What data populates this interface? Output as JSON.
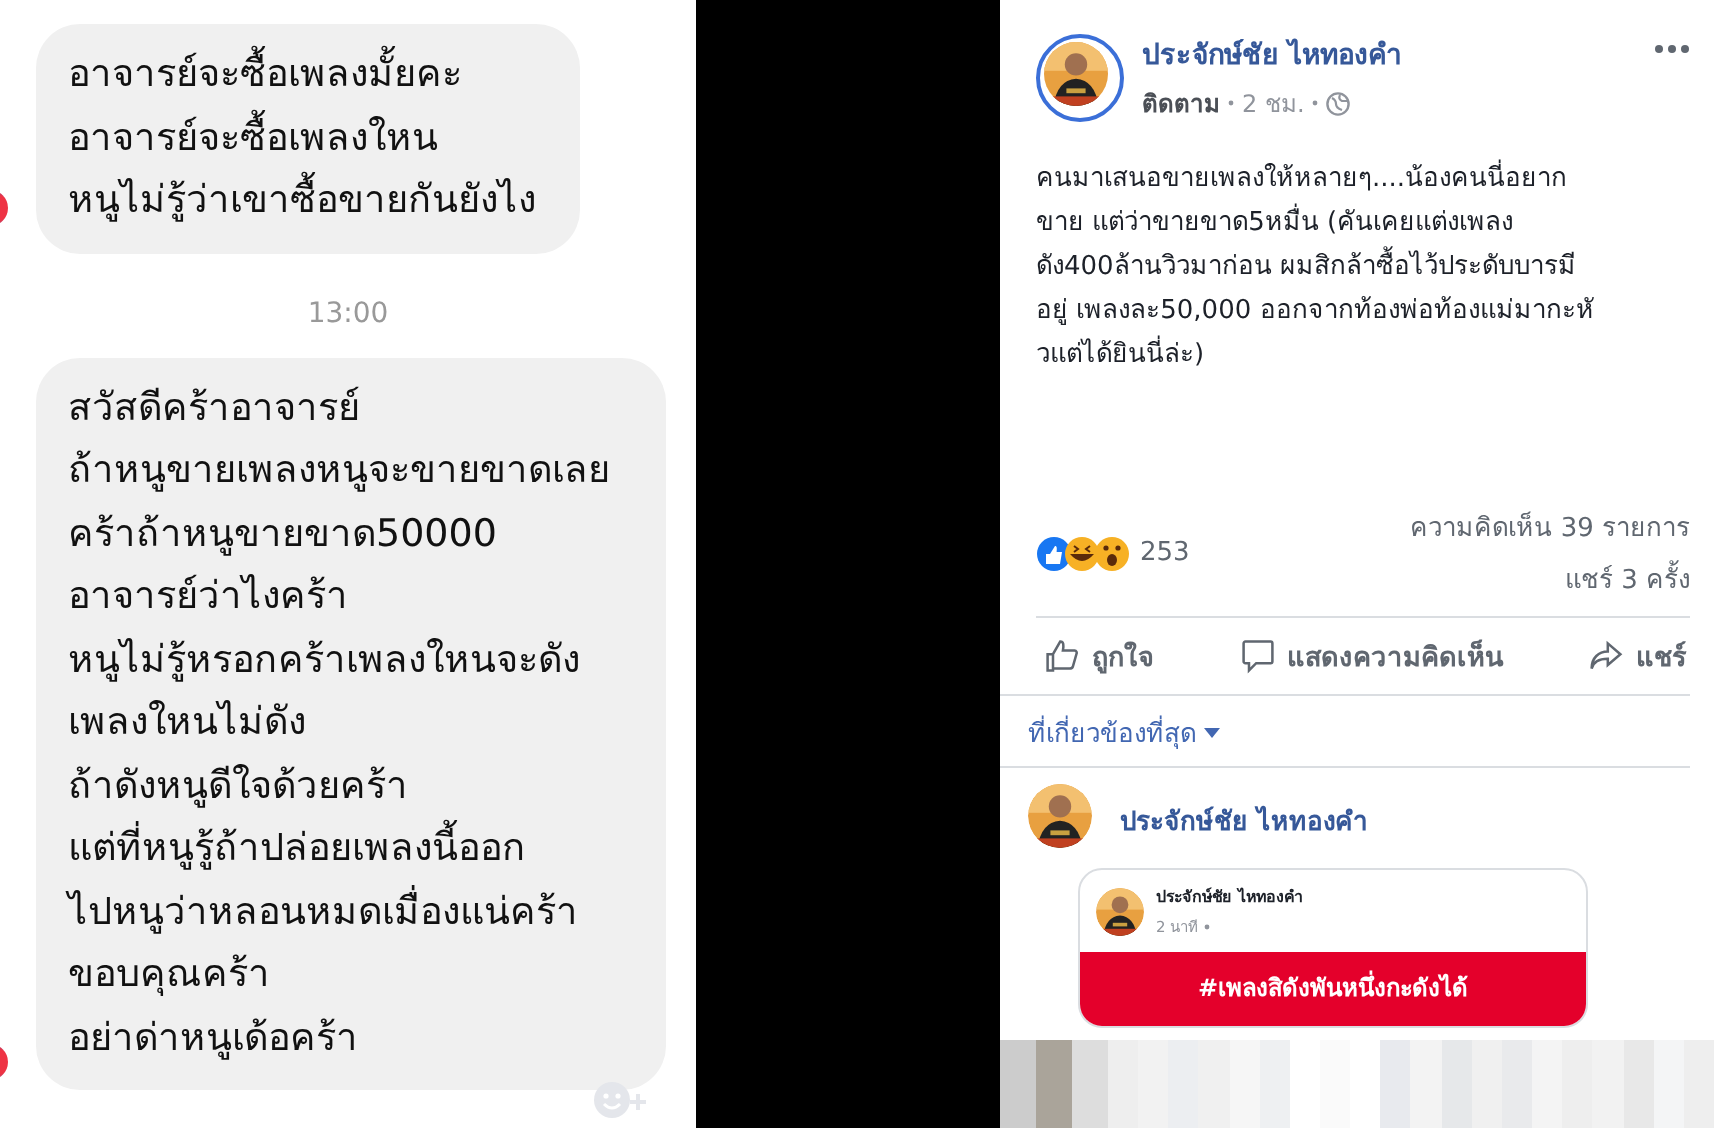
{
  "chat": {
    "messages": [
      {
        "lines": [
          "อาจารย์จะซื้อเพลงมั้ยคะ",
          "อาจารย์จะซื้อเพลงใหน",
          "หนูไม่รู้ว่าเขาซื้อขายกันยังไง"
        ]
      },
      {
        "lines": [
          "สวัสดีคร้าอาจารย์",
          "ถ้าหนูขายเพลงหนูจะขายขาดเลย",
          "คร้าถ้าหนูขายขาด50000",
          "อาจารย์ว่าไงคร้า",
          "หนูไม่รู้หรอกคร้าเพลงใหนจะดัง",
          "เพลงใหนไม่ดัง",
          "ถ้าดังหนูดีใจด้วยคร้า",
          "แต่ที่หนูรู้ถ้าปล่อยเพลงนี้ออก",
          "ไปหนูว่าหลอนหมดเมื่องแน่คร้า",
          "ขอบคุณคร้า",
          "อย่าด่าหนูเด้อคร้า"
        ]
      }
    ],
    "time": "13:00"
  },
  "post": {
    "author": "ประจักษ์ชัย ไหทองคำ",
    "follow": "ติดตาม",
    "age": "2 ชม.",
    "body": [
      "คนมาเสนอขายเพลงให้หลายๆ....น้องคนนี่อยาก",
      "ขาย แต่ว่าขายขาด5หมื่น (คันเคยแต่งเพลง",
      "ดัง400ล้านวิวมาก่อน ผมสิกล้าซื้อไว้ประดับบารมี",
      "อยู่ เพลงละ50,000 ออกจากท้องพ่อท้องแม่มากะหั",
      "วแต่ได้ยินนี่ล่ะ)"
    ],
    "reactions_count": "253",
    "comments": "ความคิดเห็น 39 รายการ",
    "shares": "แชร์ 3 ครั้ง",
    "actions": [
      {
        "kind": "like",
        "label": "ถูกใจ"
      },
      {
        "kind": "comment",
        "label": "แสดงความคิดเห็น"
      },
      {
        "kind": "share",
        "label": "แชร์"
      }
    ],
    "sort": "ที่เกี่ยวข้องที่สุด",
    "comment": {
      "author": "ประจักษ์ชัย ไหทองคำ",
      "shared_post": {
        "author": "ประจักษ์ชัย ไหทองคำ",
        "age": "2 นาที",
        "banner": "#เพลงสิดังพันหนึ่งกะดังได้"
      }
    }
  }
}
